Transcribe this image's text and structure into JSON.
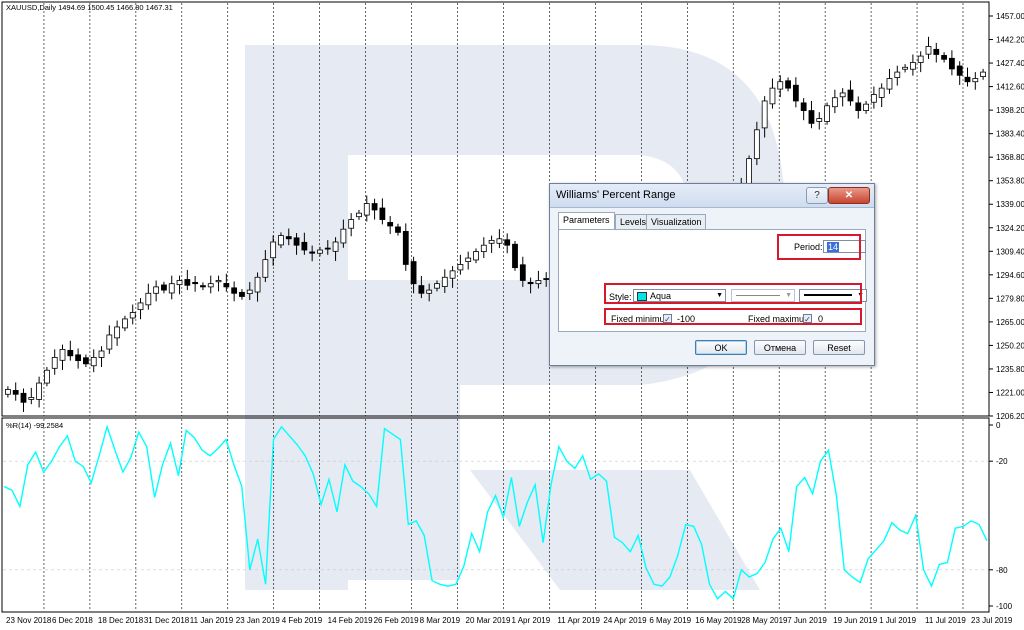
{
  "chart": {
    "symbol_header": "XAUUSD,Daily  1494.69 1500.45 1466.80 1467.31",
    "indicator_label": "%R(14) -99.2584",
    "price_ticks": [
      "1457.00",
      "1442.20",
      "1427.40",
      "1412.60",
      "1398.20",
      "1383.40",
      "1368.80",
      "1353.80",
      "1339.00",
      "1324.20",
      "1309.40",
      "1294.60",
      "1279.80",
      "1265.00",
      "1250.20",
      "1235.80",
      "1221.00",
      "1206.20"
    ],
    "wpr_ticks": [
      "0",
      "-20",
      "-80",
      "-100"
    ],
    "date_ticks": [
      "23 Nov 2018",
      "6 Dec 2018",
      "18 Dec 2018",
      "31 Dec 2018",
      "11 Jan 2019",
      "23 Jan 2019",
      "4 Feb 2019",
      "14 Feb 2019",
      "26 Feb 2019",
      "8 Mar 2019",
      "20 Mar 2019",
      "1 Apr 2019",
      "11 Apr 2019",
      "24 Apr 2019",
      "6 May 2019",
      "16 May 2019",
      "28 May 2019",
      "7 Jun 2019",
      "19 Jun 2019",
      "1 Jul 2019",
      "11 Jul 2019",
      "23 Jul 2019"
    ],
    "colors": {
      "wpr_line": "#00ffff",
      "candle": "#000000",
      "grid": "#000000",
      "watermark": "#e6eaf3"
    }
  },
  "chart_data": {
    "type": "candlestick",
    "price_axis": {
      "min": 1206.2,
      "max": 1457.0
    },
    "wpr_axis": {
      "min": -100,
      "max": 0
    },
    "price_path": [
      1224,
      1221,
      1216,
      1219,
      1228,
      1236,
      1244,
      1249,
      1245,
      1242,
      1240,
      1244,
      1248,
      1258,
      1263,
      1268,
      1272,
      1278,
      1284,
      1288,
      1286,
      1290,
      1292,
      1289,
      1290,
      1288,
      1290,
      1292,
      1288,
      1284,
      1282,
      1286,
      1294,
      1305,
      1316,
      1320,
      1318,
      1314,
      1311,
      1309,
      1311,
      1312,
      1316,
      1324,
      1330,
      1334,
      1340,
      1336,
      1330,
      1326,
      1322,
      1302,
      1290,
      1284,
      1286,
      1290,
      1294,
      1298,
      1302,
      1306,
      1310,
      1314,
      1317,
      1318,
      1314,
      1300,
      1292,
      1290,
      1292,
      1293,
      1298,
      1304,
      1308,
      1309,
      1308,
      1306,
      1290,
      1284,
      1282,
      1280,
      1278,
      1276,
      1278,
      1280,
      1284,
      1288,
      1292,
      1296,
      1298,
      1304,
      1310,
      1318,
      1328,
      1340,
      1352,
      1368,
      1386,
      1404,
      1412,
      1416,
      1412,
      1404,
      1398,
      1390,
      1393,
      1401,
      1406,
      1409,
      1404,
      1398,
      1402,
      1408,
      1412,
      1418,
      1422,
      1425,
      1428,
      1432,
      1438,
      1433,
      1430,
      1424,
      1420,
      1416,
      1418,
      1422
    ],
    "wpr_values": [
      -34,
      -36,
      -45,
      -22,
      -15,
      -26,
      -20,
      -12,
      -6,
      -20,
      -23,
      -32,
      -17,
      -1,
      -14,
      -26,
      -18,
      -4,
      -12,
      -40,
      -22,
      -10,
      -28,
      -3,
      -7,
      -14,
      -17,
      -13,
      -8,
      -22,
      -34,
      -80,
      -63,
      -88,
      -8,
      -1,
      -6,
      -11,
      -17,
      -27,
      -44,
      -30,
      -48,
      -22,
      -31,
      -34,
      -38,
      -45,
      -2,
      -5,
      -8,
      -55,
      -53,
      -61,
      -86,
      -88,
      -89,
      -88,
      -78,
      -60,
      -70,
      -48,
      -39,
      -51,
      -29,
      -56,
      -43,
      -33,
      -65,
      -33,
      -12,
      -20,
      -24,
      -17,
      -30,
      -27,
      -31,
      -62,
      -65,
      -70,
      -61,
      -79,
      -88,
      -89,
      -84,
      -72,
      -55,
      -56,
      -66,
      -88,
      -96,
      -92,
      -96,
      -80,
      -84,
      -82,
      -76,
      -63,
      -57,
      -70,
      -34,
      -29,
      -38,
      -20,
      -14,
      -39,
      -80,
      -84,
      -87,
      -74,
      -69,
      -64,
      -54,
      -58,
      -60,
      -50,
      -80,
      -89,
      -77,
      -76,
      -57,
      -56,
      -53,
      -55,
      -64
    ],
    "wpr_series": [
      -33,
      -34,
      -46,
      -22,
      -15,
      -26,
      -20,
      -11,
      -5,
      -20,
      -24,
      -33,
      -18,
      0,
      -15,
      -27,
      -18,
      -3,
      -12,
      -41,
      -23,
      -9,
      -29,
      -2,
      -7,
      -14,
      -17,
      -13,
      -8,
      -22,
      -35,
      -81,
      -64,
      -89,
      -8,
      0,
      -6,
      -11,
      -17,
      -28,
      -45,
      -30,
      -48,
      -23,
      -31,
      -34,
      -38,
      -45,
      -1,
      -4,
      -8,
      -56,
      -53,
      -62,
      -87,
      -89,
      -90,
      -89,
      -79,
      -60,
      -71,
      -48,
      -39,
      -52,
      -29,
      -57,
      -43,
      -34,
      -66,
      -33,
      -12,
      -20,
      -24,
      -17,
      -31,
      -27,
      -32,
      -63,
      -66,
      -71,
      -62,
      -80,
      -89,
      -90,
      -85,
      -73,
      -56,
      -57,
      -67,
      -89,
      -97,
      -93,
      -97,
      -81,
      -85,
      -83,
      -77,
      -64,
      -58,
      -71,
      -34,
      -29,
      -38,
      -20,
      -14,
      -40,
      -81,
      -85,
      -88,
      -75,
      -70,
      -65,
      -55,
      -59,
      -61,
      -51,
      -81,
      -90,
      -78,
      -77,
      -58,
      -57,
      -54,
      -56,
      -65
    ],
    "wpr_levels": [
      -20,
      -80
    ]
  },
  "dialog": {
    "title": "Williams' Percent Range",
    "help_button": "?",
    "close_button": "✕",
    "tabs": [
      {
        "label": "Parameters"
      },
      {
        "label": "Levels"
      },
      {
        "label": "Visualization"
      }
    ],
    "period_label": "Period:",
    "period_value": "14",
    "style_label": "Style:",
    "style_color_name": "Aqua",
    "style_color_hex": "#00e5e5",
    "fixed_minimum_label": "Fixed minimum",
    "fixed_minimum_checked": "✓",
    "fixed_minimum_value": "-100",
    "fixed_maximum_label": "Fixed maximum",
    "fixed_maximum_checked": "✓",
    "fixed_maximum_value": "0",
    "ok_button": "OK",
    "cancel_button": "Отмена",
    "reset_button": "Reset"
  }
}
